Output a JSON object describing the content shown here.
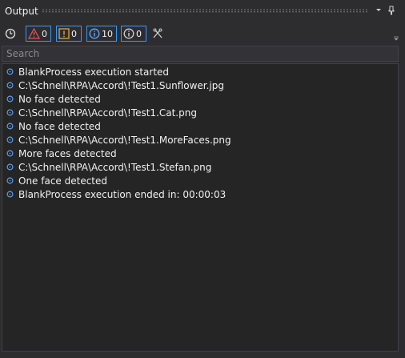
{
  "window": {
    "title": "Output",
    "dropdown_icon": "chevron-down-icon",
    "pin_icon": "pin-icon"
  },
  "toolbar": {
    "history_icon": "clock-icon",
    "errors_count": "0",
    "warnings_count": "0",
    "info_count": "10",
    "trace_count": "0",
    "clear_icon": "clear-icon"
  },
  "search": {
    "placeholder": "Search",
    "value": ""
  },
  "log": {
    "lines": [
      "BlankProcess execution started",
      "C:\\Schnell\\RPA\\Accord\\!Test1.Sunflower.jpg",
      "No face detected",
      "C:\\Schnell\\RPA\\Accord\\!Test1.Cat.png",
      "No face detected",
      "C:\\Schnell\\RPA\\Accord\\!Test1.MoreFaces.png",
      "More faces detected",
      "C:\\Schnell\\RPA\\Accord\\!Test1.Stefan.png",
      "One face detected",
      "BlankProcess execution ended in: 00:00:03"
    ]
  },
  "colors": {
    "error": "#e85151",
    "warning": "#e8a33d",
    "info": "#5fa8ff",
    "trace": "#cfcfcf",
    "accent": "#3399ff",
    "background": "#2d2d30",
    "content_bg": "#252526"
  }
}
